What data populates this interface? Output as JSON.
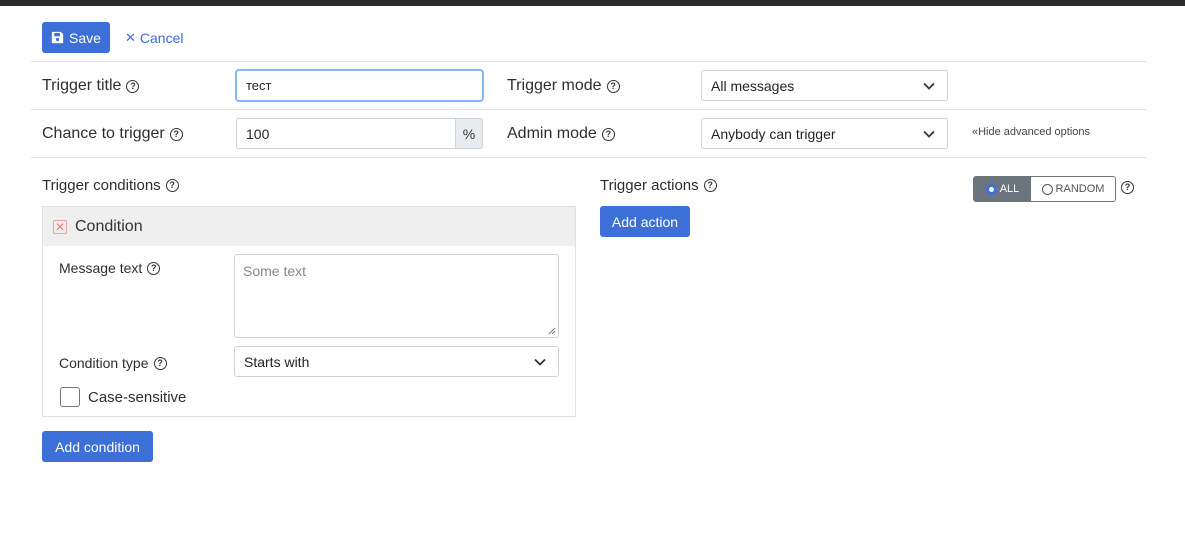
{
  "toolbar": {
    "save_label": "Save",
    "cancel_label": "Cancel"
  },
  "form": {
    "trigger_title": {
      "label": "Trigger title",
      "value": "тест"
    },
    "trigger_mode": {
      "label": "Trigger mode",
      "selected": "All messages"
    },
    "chance": {
      "label": "Chance to trigger",
      "value": "100",
      "unit": "%"
    },
    "admin_mode": {
      "label": "Admin mode",
      "selected": "Anybody can trigger"
    },
    "advanced_toggle": "«Hide advanced options"
  },
  "conditions": {
    "heading": "Trigger conditions",
    "items": [
      {
        "title": "Condition",
        "message_label": "Message text",
        "message_placeholder": "Some text",
        "type_label": "Condition type",
        "type_selected": "Starts with",
        "case_label": "Case-sensitive",
        "case_checked": false
      }
    ],
    "add_label": "Add condition"
  },
  "actions": {
    "heading": "Trigger actions",
    "add_label": "Add action",
    "mode_options": [
      "ALL",
      "RANDOM"
    ],
    "mode_selected": "ALL"
  },
  "colors": {
    "primary": "#3c6fd8",
    "toggle_active": "#6c757d",
    "header_bar": "#2b2b2b"
  }
}
